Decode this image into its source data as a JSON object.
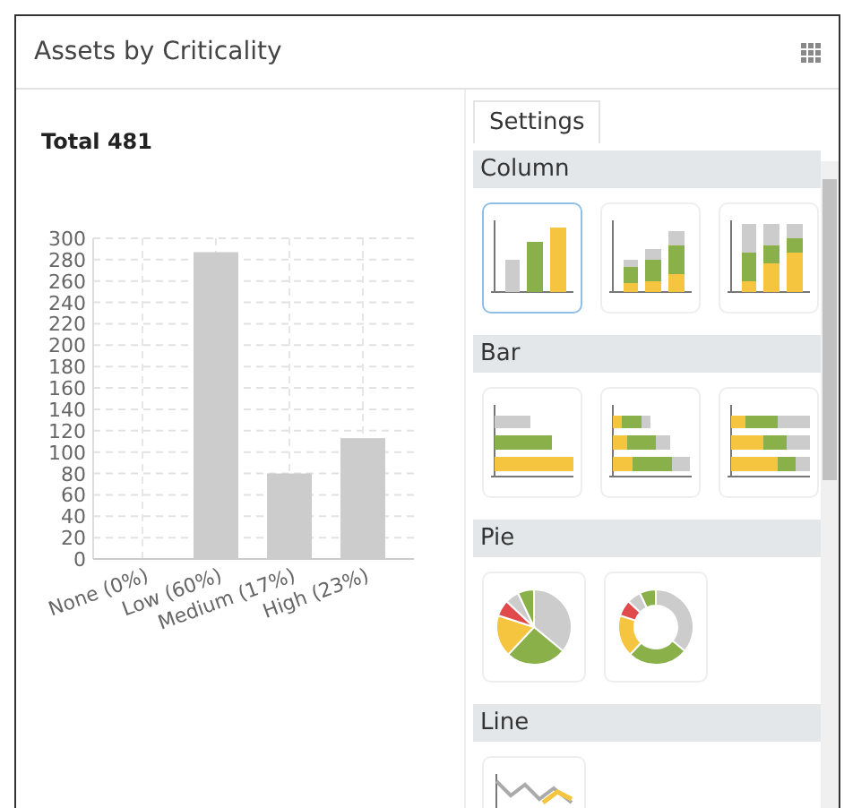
{
  "panel": {
    "title": "Assets by Criticality"
  },
  "summary": {
    "total": "Total 481"
  },
  "chart_data": {
    "type": "bar",
    "categories": [
      "None (0%)",
      "Low (60%)",
      "Medium (17%)",
      "High (23%)"
    ],
    "series": [
      {
        "color": "#cccccc",
        "values": [
          0,
          287,
          80,
          113
        ]
      }
    ],
    "grid": true,
    "ylim": [
      0,
      300
    ],
    "yticks": [
      0,
      20,
      40,
      60,
      80,
      100,
      120,
      140,
      160,
      180,
      200,
      220,
      240,
      260,
      280,
      300
    ]
  },
  "settings": {
    "tabs": [
      {
        "label": "Settings",
        "selected": true
      }
    ],
    "sections": [
      {
        "title": "Column",
        "options": [
          {
            "kind": "column-clustered",
            "selected": true
          },
          {
            "kind": "column-stacked",
            "selected": false
          },
          {
            "kind": "column-percent",
            "selected": false
          }
        ]
      },
      {
        "title": "Bar",
        "options": [
          {
            "kind": "bar-clustered",
            "selected": false
          },
          {
            "kind": "bar-stacked",
            "selected": false
          },
          {
            "kind": "bar-percent",
            "selected": false
          }
        ]
      },
      {
        "title": "Pie",
        "options": [
          {
            "kind": "pie",
            "selected": false
          },
          {
            "kind": "donut",
            "selected": false
          }
        ]
      },
      {
        "title": "Line",
        "options": [
          {
            "kind": "line",
            "selected": false
          }
        ]
      }
    ]
  }
}
